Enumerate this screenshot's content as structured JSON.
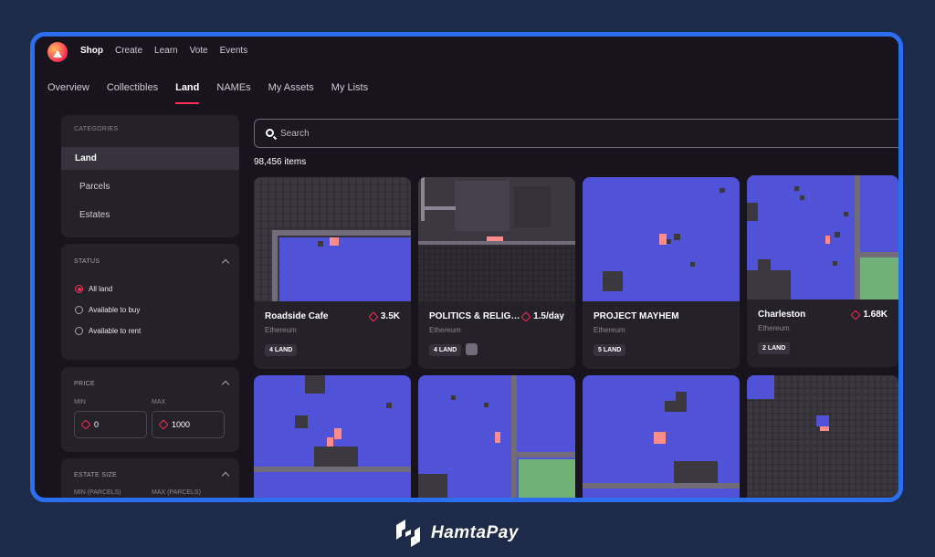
{
  "topnav": {
    "items": [
      "Shop",
      "Create",
      "Learn",
      "Vote",
      "Events"
    ],
    "active": "Shop"
  },
  "tabs": [
    "Overview",
    "Collectibles",
    "Land",
    "NAMEs",
    "My Assets",
    "My Lists"
  ],
  "sidebar": {
    "categories": {
      "heading": "CATEGORIES",
      "items": [
        "Land",
        "Parcels",
        "Estates"
      ]
    },
    "status": {
      "heading": "STATUS",
      "options": [
        "All land",
        "Available to buy",
        "Available to rent"
      ]
    },
    "price": {
      "heading": "PRICE",
      "min_label": "MIN",
      "max_label": "MAX",
      "min_value": "0",
      "max_value": "1000"
    },
    "estate_size": {
      "heading": "ESTATE SIZE",
      "min_label": "MIN (PARCELS)",
      "max_label": "MAX (PARCELS)"
    }
  },
  "search": {
    "placeholder": "Search"
  },
  "results": {
    "count": "98,456 items"
  },
  "cards": [
    {
      "title": "Roadside Cafe",
      "chain": "Ethereum",
      "price": "3.5K",
      "badge": "4 LAND"
    },
    {
      "title": "POLITICS & RELIGION",
      "chain": "Ethereum",
      "price": "1.5/day",
      "badge": "4 LAND"
    },
    {
      "title": "PROJECT MAYHEM",
      "chain": "Ethereum",
      "price": "",
      "badge": "5 LAND"
    },
    {
      "title": "Charleston",
      "chain": "Ethereum",
      "price": "1.68K",
      "badge": "2 LAND"
    }
  ],
  "brand": {
    "name": "HamtaPay"
  },
  "colors": {
    "accent": "#ff2d55",
    "frame": "#2b6ff0",
    "background": "#1e2a4a",
    "land_blue": "#5053d8",
    "land_dark": "#3b3840",
    "land_green": "#70b178"
  }
}
